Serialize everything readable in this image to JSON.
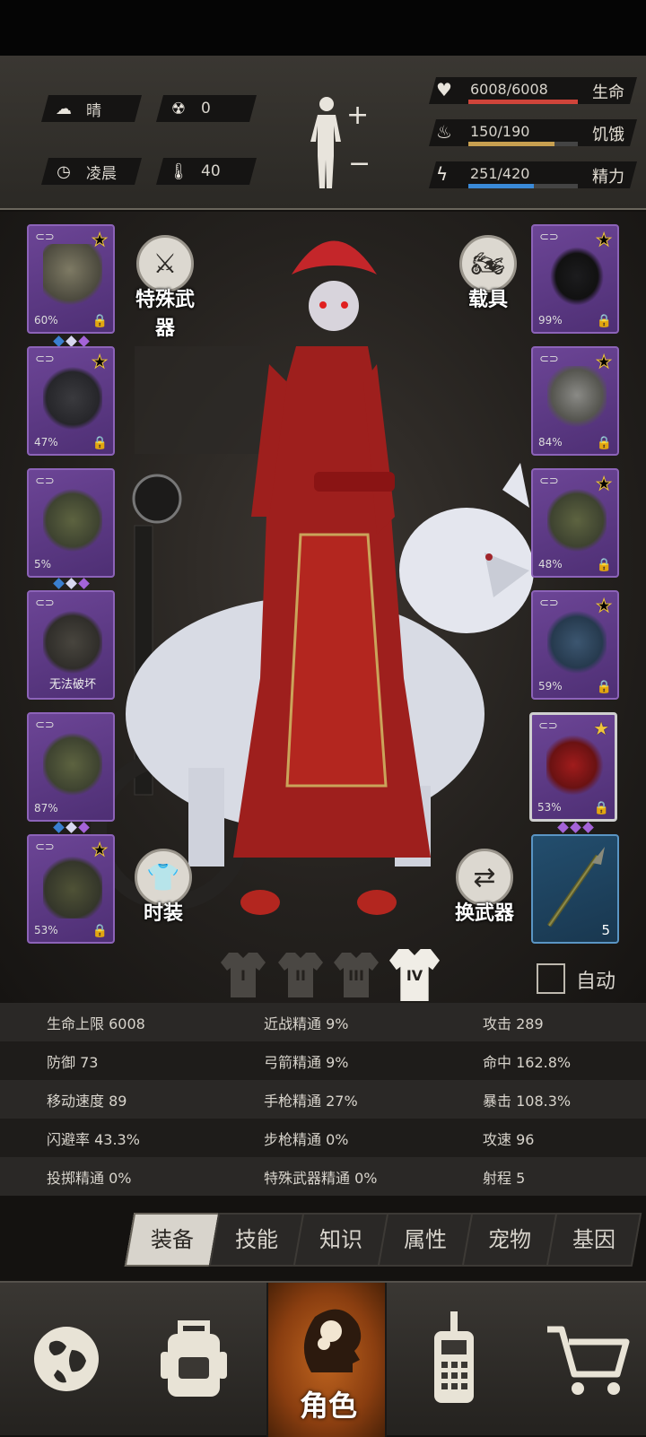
{
  "status": {
    "weather": {
      "icon": "cloud-sun-icon",
      "label": "晴"
    },
    "radiation": {
      "icon": "radiation-icon",
      "value": "0"
    },
    "time": {
      "icon": "clock-icon",
      "label": "凌晨"
    },
    "temperature": {
      "icon": "thermometer-icon",
      "value": "40"
    },
    "bars": [
      {
        "icon": "heart-icon",
        "value": "6008/6008",
        "label": "生命",
        "fill": 1.0,
        "color": "#d0443a"
      },
      {
        "icon": "stomach-icon",
        "value": "150/190",
        "label": "饥饿",
        "fill": 0.79,
        "color": "#c8a050"
      },
      {
        "icon": "energy-icon",
        "value": "251/420",
        "label": "精力",
        "fill": 0.6,
        "color": "#3a8ad8"
      }
    ]
  },
  "left_slots": [
    {
      "name": "helmet",
      "pct": "60%",
      "durability": 0.6,
      "gems": [
        "#3a7fd0",
        "#d8d8f0",
        "#a463d8"
      ]
    },
    {
      "name": "jacket",
      "pct": "47%",
      "durability": 0.47
    },
    {
      "name": "camo-suit",
      "pct": "5%",
      "durability": 0.05,
      "gems": [
        "#3a7fd0",
        "#d8d8f0",
        "#a463d8"
      ]
    },
    {
      "name": "backpack",
      "text": "无法破坏"
    },
    {
      "name": "pants",
      "pct": "87%",
      "durability": 0.87,
      "gems": [
        "#3a7fd0",
        "#d8d8f0",
        "#a463d8"
      ]
    },
    {
      "name": "boots",
      "pct": "53%",
      "durability": 0.53
    }
  ],
  "right_slots": [
    {
      "name": "goggles",
      "pct": "99%",
      "durability": 0.99
    },
    {
      "name": "gas-mask",
      "pct": "84%",
      "durability": 0.84
    },
    {
      "name": "vest",
      "pct": "48%",
      "durability": 0.48
    },
    {
      "name": "shield",
      "pct": "59%",
      "durability": 0.59
    },
    {
      "name": "red-pistol",
      "pct": "53%",
      "durability": 0.53,
      "gems": [
        "#a463d8",
        "#a463d8",
        "#a463d8"
      ]
    },
    {
      "name": "spear",
      "count": "5"
    }
  ],
  "buttons": {
    "special_weapon": "特殊武器",
    "vehicle": "载具",
    "fashion": "时装",
    "switch_weapon": "换武器",
    "auto": "自动"
  },
  "outfit_tabs": [
    "I",
    "II",
    "III",
    "IV"
  ],
  "stats": [
    [
      "生命上限 6008",
      "近战精通 9%",
      "攻击 289"
    ],
    [
      "防御 73",
      "弓箭精通 9%",
      "命中 162.8%"
    ],
    [
      "移动速度 89",
      "手枪精通 27%",
      "暴击 108.3%"
    ],
    [
      "闪避率 43.3%",
      "步枪精通 0%",
      "攻速 96"
    ],
    [
      "投掷精通 0%",
      "特殊武器精通 0%",
      "射程 5"
    ]
  ],
  "tabs": [
    "装备",
    "技能",
    "知识",
    "属性",
    "宠物",
    "基因"
  ],
  "nav": {
    "map": "globe-icon",
    "bag": "backpack-icon",
    "character": "角色",
    "radio": "walkie-talkie-icon",
    "shop": "cart-icon"
  }
}
